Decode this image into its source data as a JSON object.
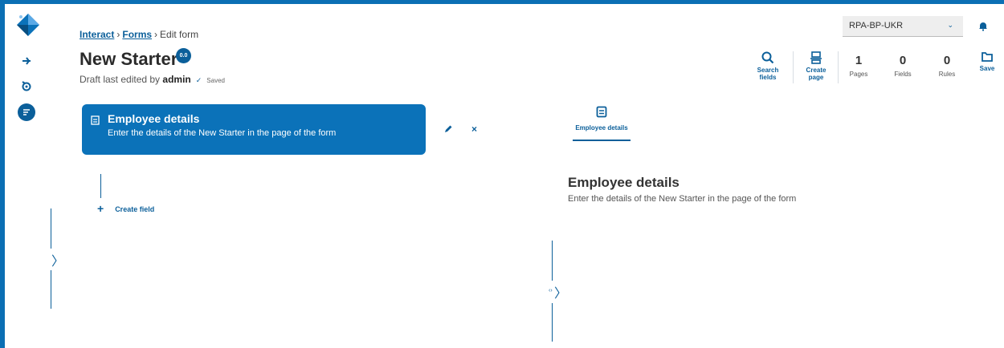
{
  "app": {
    "accent_color": "#0b5f9a",
    "card_color": "#0b72b9"
  },
  "rail": {
    "items": [
      {
        "icon": "logo-icon"
      },
      {
        "icon": "interact-icon"
      },
      {
        "icon": "gear-refresh-icon"
      },
      {
        "icon": "forms-icon",
        "active": true
      }
    ]
  },
  "breadcrumb": {
    "items": [
      "Interact",
      "Forms"
    ],
    "current": "Edit form",
    "separator": "›"
  },
  "header": {
    "title": "New Starter",
    "version": "0.0",
    "draft_prefix": "Draft last edited by",
    "draft_user": "admin",
    "status": "Saved",
    "status_check": "✓"
  },
  "toolbar": {
    "search_label_1": "Search",
    "search_label_2": "fields",
    "create_label_1": "Create",
    "create_label_2": "page",
    "stats": [
      {
        "value": "1",
        "label": "Pages"
      },
      {
        "value": "0",
        "label": "Fields"
      },
      {
        "value": "0",
        "label": "Rules"
      }
    ],
    "save_label": "Save"
  },
  "environment": {
    "selected": "RPA-BP-UKR",
    "chevron": "⌄"
  },
  "page_card": {
    "title": "Employee details",
    "description": "Enter the details of the New Starter in the page of the form",
    "delete_symbol": "×"
  },
  "builder": {
    "create_field_label": "Create field",
    "plus": "+"
  },
  "handles": {
    "left": "〉",
    "right": "〉",
    "right_prefix": "‹›"
  },
  "preview": {
    "tab_label": "Employee details",
    "title": "Employee details",
    "description": "Enter the details of the New Starter in the page of the form"
  }
}
